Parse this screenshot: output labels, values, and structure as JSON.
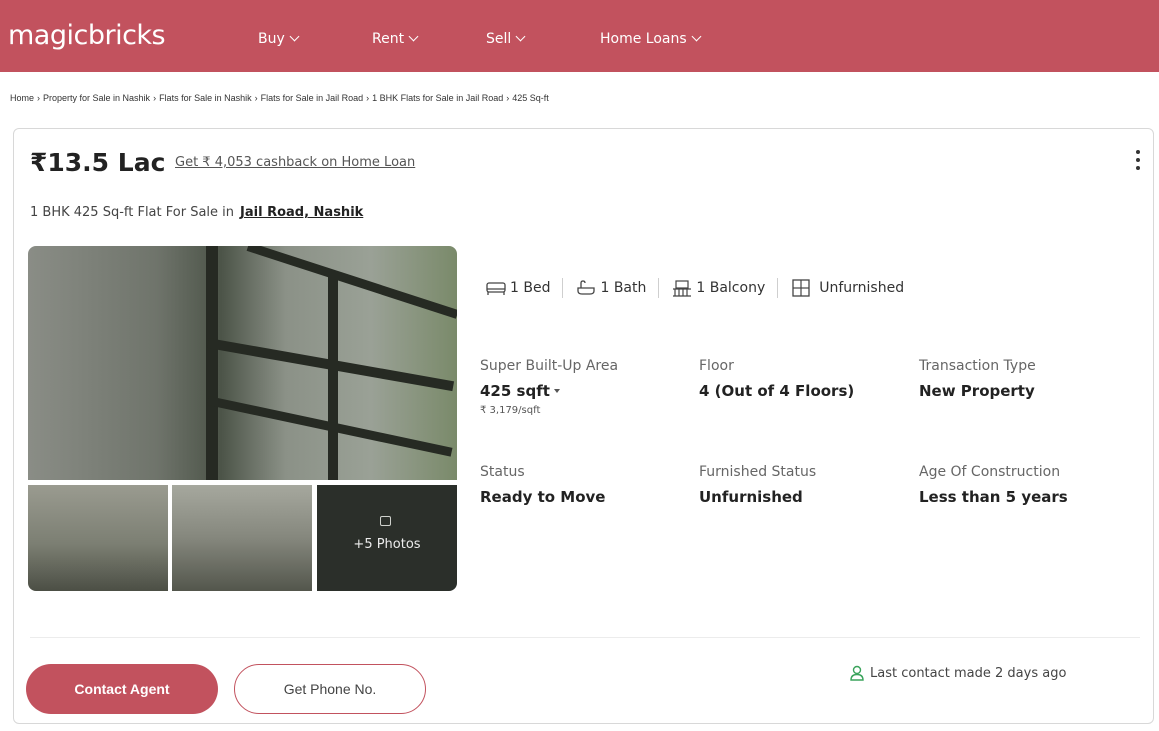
{
  "header": {
    "logo": "magicbricks",
    "nav": [
      "Buy",
      "Rent",
      "Sell",
      "Home Loans"
    ]
  },
  "breadcrumb": [
    "Home",
    "Property for Sale in Nashik",
    "Flats for Sale in Nashik",
    "Flats for Sale in Jail Road",
    "1 BHK Flats for Sale in Jail Road",
    "425 Sq-ft"
  ],
  "breadcrumb_separator": "›",
  "listing": {
    "price": "₹13.5 Lac",
    "cashback": "Get ₹ 4,053 cashback on Home Loan",
    "title_prefix": "1 BHK 425 Sq-ft Flat For Sale in",
    "location": "Jail Road, Nashik",
    "photos_more": "+5 Photos",
    "amenities": [
      {
        "icon": "bed-icon",
        "label": "1 Bed"
      },
      {
        "icon": "bath-icon",
        "label": "1 Bath"
      },
      {
        "icon": "balcony-icon",
        "label": "1 Balcony"
      },
      {
        "icon": "furnishing-icon",
        "label": "Unfurnished"
      }
    ],
    "specs": {
      "area_label": "Super Built-Up Area",
      "area_value": "425 sqft",
      "price_per_sqft": "₹ 3,179/sqft",
      "floor_label": "Floor",
      "floor_value": "4 (Out of 4 Floors)",
      "transaction_label": "Transaction Type",
      "transaction_value": "New Property",
      "status_label": "Status",
      "status_value": "Ready to Move",
      "furnished_label": "Furnished Status",
      "furnished_value": "Unfurnished",
      "age_label": "Age Of Construction",
      "age_value": "Less than 5 years"
    }
  },
  "actions": {
    "contact_agent": "Contact Agent",
    "get_phone": "Get Phone No.",
    "last_contact": "Last contact made 2 days ago"
  },
  "colors": {
    "brand": "#c2525e",
    "accent_green": "#3aa35b"
  }
}
